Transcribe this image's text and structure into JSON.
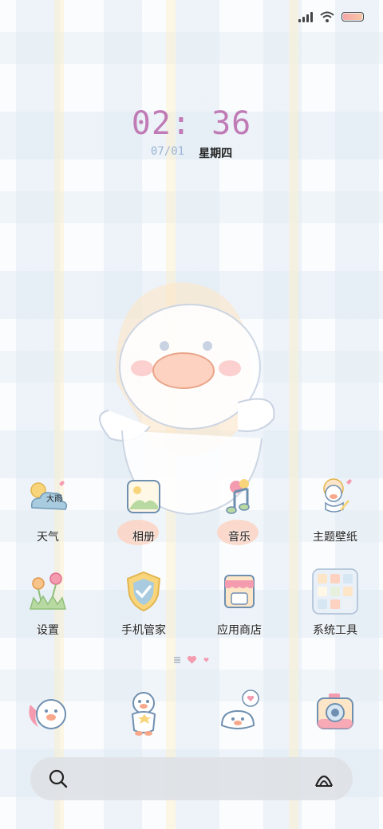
{
  "clock": {
    "time": "02: 36",
    "date": "07/01",
    "weekday": "星期四"
  },
  "apps": [
    {
      "label": "天气",
      "icon": "weather-icon",
      "badge": "大雨"
    },
    {
      "label": "相册",
      "icon": "gallery-icon"
    },
    {
      "label": "音乐",
      "icon": "music-icon"
    },
    {
      "label": "主题壁纸",
      "icon": "theme-icon"
    },
    {
      "label": "设置",
      "icon": "settings-flower-icon"
    },
    {
      "label": "手机管家",
      "icon": "security-shield-icon"
    },
    {
      "label": "应用商店",
      "icon": "app-store-icon"
    },
    {
      "label": "系统工具",
      "icon": "system-tools-folder-icon"
    }
  ],
  "dock": [
    {
      "icon": "phone-duck-icon"
    },
    {
      "icon": "contacts-duck-icon"
    },
    {
      "icon": "messages-duck-icon"
    },
    {
      "icon": "camera-icon"
    }
  ],
  "colors": {
    "time": "#c07ab5",
    "date": "#9ab4d6",
    "accent_pink": "#f59bb0"
  }
}
